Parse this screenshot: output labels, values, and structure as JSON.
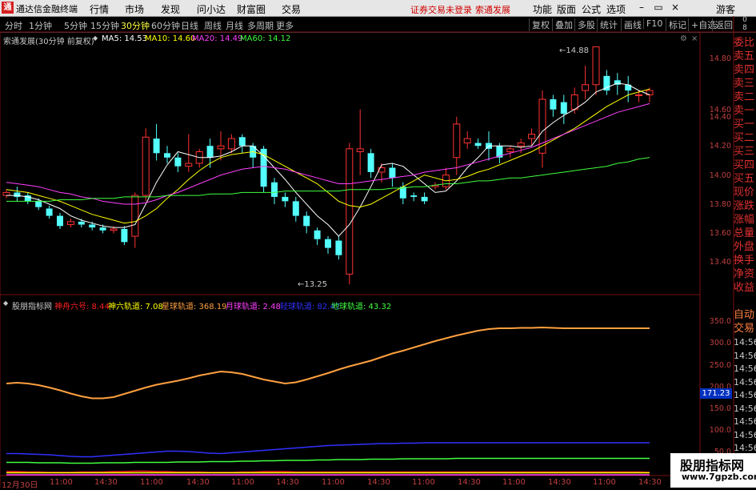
{
  "menubar": {
    "logo": "通",
    "app_title": "通达信金融终端",
    "menus": [
      "行情",
      "市场",
      "发现",
      "问小达",
      "财富圈",
      "交易"
    ],
    "warnings": [
      "证券交易未登录",
      "索通发展"
    ],
    "right_menus": [
      "功能",
      "版面",
      "公式",
      "选项"
    ],
    "user": "游客"
  },
  "toolbar": {
    "periods": [
      "分时",
      "1分钟",
      "5分钟",
      "15分钟",
      "30分钟",
      "60分钟",
      "日线",
      "周线",
      "月线",
      "多周期",
      "更多"
    ],
    "active_period": "30分钟",
    "right_buttons": [
      "复权",
      "叠加",
      "多股",
      "统计",
      "画线",
      "F10",
      "标记",
      "+自选",
      "返回"
    ]
  },
  "main_header": {
    "title": "索通发展(30分钟 前复权)",
    "ma": [
      {
        "label": "MA5: 14.53",
        "color": "#ffffff"
      },
      {
        "label": "MA10: 14.60",
        "color": "#ffff00"
      },
      {
        "label": "MA20: 14.49",
        "color": "#ff40ff"
      },
      {
        "label": "MA60: 14.12",
        "color": "#40ff40"
      }
    ]
  },
  "sub_header": {
    "title": "股朋指标网",
    "items": [
      {
        "label": "神舟六号: 8.44",
        "color": "#ff2020"
      },
      {
        "label": "神六轨道: 7.08",
        "color": "#ffff00"
      },
      {
        "label": "星球轨道: 368.19",
        "color": "#ffa040"
      },
      {
        "label": "月球轨道: 2.48",
        "color": "#ff40ff"
      },
      {
        "label": "轻球轨道: 82.47",
        "color": "#3030ff"
      },
      {
        "label": "地球轨道: 43.32",
        "color": "#40ff40"
      }
    ]
  },
  "price_axis": [
    "14.80",
    "14.60",
    "14.40",
    "14.20",
    "14.00",
    "13.80",
    "13.60",
    "13.40"
  ],
  "indicator_axis": [
    "350.0",
    "300.0",
    "250.0",
    "200.0",
    "150.0",
    "100.0",
    "50.0"
  ],
  "indicator_current": "171.23",
  "annotations": {
    "high": "14.88",
    "low": "13.25"
  },
  "right_panel": {
    "top": [
      "委比",
      "卖五",
      "卖四",
      "卖三",
      "卖二",
      "卖一",
      "买一",
      "买二",
      "买三",
      "买四",
      "买五",
      "现价",
      "涨跌",
      "涨幅",
      "总量",
      "外盘",
      "换手",
      "净资",
      "收益"
    ],
    "bottom_tabs": [
      "自动",
      "交易"
    ],
    "times": [
      "14:56",
      "14:56",
      "14:56",
      "14:56",
      "14:56",
      "14:56",
      "14:56",
      "14:56",
      "14:56",
      "14:56",
      "14:56"
    ]
  },
  "x_axis": [
    "12月30日",
    "11:00",
    "14:30",
    "11:00",
    "14:30",
    "11:00",
    "14:30",
    "11:00",
    "14:30",
    "11:00",
    "14:30",
    "11:00",
    "14:30",
    "11:00",
    "14:30"
  ],
  "badges": [
    "0",
    "8"
  ],
  "colors": {
    "up": "#ff3232",
    "down": "#54ffff",
    "axis": "#c04040"
  },
  "chart_data": {
    "type": "candlestick",
    "ylim": [
      13.2,
      14.95
    ],
    "candles": [
      [
        13.86,
        13.88,
        13.84,
        13.9
      ],
      [
        13.88,
        13.85,
        13.82,
        13.92
      ],
      [
        13.86,
        13.82,
        13.8,
        13.88
      ],
      [
        13.82,
        13.78,
        13.76,
        13.84
      ],
      [
        13.77,
        13.72,
        13.7,
        13.79
      ],
      [
        13.72,
        13.65,
        13.63,
        13.74
      ],
      [
        13.66,
        13.68,
        13.64,
        13.7
      ],
      [
        13.68,
        13.66,
        13.64,
        13.7
      ],
      [
        13.66,
        13.64,
        13.62,
        13.68
      ],
      [
        13.64,
        13.62,
        13.6,
        13.66
      ],
      [
        13.62,
        13.63,
        13.6,
        13.65
      ],
      [
        13.63,
        13.54,
        13.52,
        13.65
      ],
      [
        13.58,
        13.86,
        13.5,
        13.88
      ],
      [
        13.86,
        14.26,
        13.82,
        14.32
      ],
      [
        14.25,
        14.15,
        14.1,
        14.35
      ],
      [
        14.15,
        14.12,
        14.08,
        14.2
      ],
      [
        14.12,
        14.06,
        14.02,
        14.15
      ],
      [
        14.06,
        14.08,
        14.02,
        14.28
      ],
      [
        14.08,
        14.16,
        14.05,
        14.18
      ],
      [
        14.2,
        14.12,
        14.05,
        14.25
      ],
      [
        14.18,
        14.2,
        14.1,
        14.3
      ],
      [
        14.18,
        14.25,
        14.15,
        14.28
      ],
      [
        14.26,
        14.2,
        14.15,
        14.28
      ],
      [
        14.2,
        14.12,
        14.05,
        14.22
      ],
      [
        14.18,
        13.92,
        13.88,
        14.2
      ],
      [
        13.95,
        13.85,
        13.8,
        13.98
      ],
      [
        13.85,
        13.82,
        13.78,
        13.88
      ],
      [
        13.82,
        13.72,
        13.68,
        13.85
      ],
      [
        13.72,
        13.65,
        13.6,
        13.75
      ],
      [
        13.62,
        13.56,
        13.52,
        13.64
      ],
      [
        13.56,
        13.5,
        13.46,
        13.58
      ],
      [
        13.55,
        13.45,
        13.42,
        13.58
      ],
      [
        13.32,
        14.18,
        13.25,
        14.22
      ],
      [
        14.16,
        14.18,
        14.0,
        14.45
      ],
      [
        14.15,
        14.02,
        13.98,
        14.18
      ],
      [
        14.02,
        14.05,
        13.95,
        14.08
      ],
      [
        14.05,
        13.98,
        13.92,
        14.08
      ],
      [
        13.92,
        13.84,
        13.8,
        13.95
      ],
      [
        13.86,
        13.85,
        13.82,
        13.88
      ],
      [
        13.85,
        13.82,
        13.8,
        13.88
      ],
      [
        13.92,
        13.93,
        13.9,
        13.95
      ],
      [
        13.92,
        14.0,
        13.9,
        14.05
      ],
      [
        14.12,
        14.35,
        14.0,
        14.4
      ],
      [
        14.22,
        14.25,
        14.18,
        14.3
      ],
      [
        14.22,
        14.2,
        14.18,
        14.25
      ],
      [
        14.22,
        14.18,
        14.1,
        14.3
      ],
      [
        14.2,
        14.12,
        14.08,
        14.22
      ],
      [
        14.16,
        14.18,
        14.12,
        14.2
      ],
      [
        14.2,
        14.22,
        14.15,
        14.25
      ],
      [
        14.25,
        14.28,
        14.2,
        14.32
      ],
      [
        14.15,
        14.52,
        14.05,
        14.58
      ],
      [
        14.52,
        14.45,
        14.4,
        14.55
      ],
      [
        14.5,
        14.42,
        14.35,
        14.55
      ],
      [
        14.45,
        14.55,
        14.42,
        14.6
      ],
      [
        14.58,
        14.62,
        14.52,
        14.75
      ],
      [
        14.62,
        14.88,
        14.55,
        14.88
      ],
      [
        14.68,
        14.58,
        14.55,
        14.72
      ],
      [
        14.65,
        14.62,
        14.55,
        14.7
      ],
      [
        14.62,
        14.58,
        14.5,
        14.68
      ],
      [
        14.55,
        14.55,
        14.5,
        14.58
      ],
      [
        14.55,
        14.58,
        14.5,
        14.6
      ]
    ],
    "ma_series": [
      {
        "name": "MA5",
        "color": "#ffffff",
        "values": [
          13.86,
          13.86,
          13.85,
          13.83,
          13.8,
          13.77,
          13.72,
          13.69,
          13.67,
          13.65,
          13.64,
          13.64,
          13.66,
          13.8,
          13.95,
          14.07,
          14.16,
          14.14,
          14.12,
          14.12,
          14.13,
          14.16,
          14.2,
          14.2,
          14.13,
          14.05,
          13.97,
          13.88,
          13.8,
          13.72,
          13.66,
          13.58,
          13.66,
          13.78,
          13.92,
          14.07,
          14.08,
          14.06,
          14.0,
          13.94,
          13.88,
          13.89,
          13.96,
          14.05,
          14.12,
          14.2,
          14.2,
          14.2,
          14.19,
          14.2,
          14.3,
          14.36,
          14.41,
          14.45,
          14.5,
          14.57,
          14.6,
          14.63,
          14.62,
          14.58,
          14.55
        ]
      },
      {
        "name": "MA10",
        "color": "#ffff00",
        "values": [
          13.9,
          13.89,
          13.88,
          13.86,
          13.84,
          13.82,
          13.79,
          13.76,
          13.73,
          13.71,
          13.69,
          13.67,
          13.68,
          13.72,
          13.77,
          13.84,
          13.9,
          13.97,
          14.03,
          14.08,
          14.12,
          14.14,
          14.15,
          14.16,
          14.14,
          14.1,
          14.06,
          14.02,
          13.98,
          13.94,
          13.88,
          13.82,
          13.79,
          13.78,
          13.8,
          13.84,
          13.88,
          13.92,
          13.96,
          14.0,
          13.98,
          13.96,
          13.97,
          13.99,
          14.02,
          14.04,
          14.07,
          14.1,
          14.13,
          14.16,
          14.2,
          14.24,
          14.28,
          14.32,
          14.37,
          14.42,
          14.47,
          14.51,
          14.55,
          14.57,
          14.59
        ]
      },
      {
        "name": "MA20",
        "color": "#ff40ff",
        "values": [
          13.95,
          13.94,
          13.93,
          13.92,
          13.9,
          13.88,
          13.87,
          13.85,
          13.84,
          13.82,
          13.81,
          13.8,
          13.8,
          13.81,
          13.83,
          13.86,
          13.88,
          13.91,
          13.94,
          13.97,
          14.0,
          14.02,
          14.04,
          14.05,
          14.06,
          14.05,
          14.04,
          14.02,
          14.0,
          13.98,
          13.96,
          13.94,
          13.94,
          13.95,
          13.96,
          13.97,
          13.98,
          13.99,
          14.0,
          14.02,
          14.03,
          14.04,
          14.05,
          14.07,
          14.09,
          14.11,
          14.13,
          14.15,
          14.17,
          14.19,
          14.22,
          14.25,
          14.28,
          14.31,
          14.34,
          14.37,
          14.4,
          14.43,
          14.45,
          14.47,
          14.49
        ]
      },
      {
        "name": "MA60",
        "color": "#40ff40",
        "values": [
          13.82,
          13.82,
          13.82,
          13.82,
          13.82,
          13.83,
          13.83,
          13.83,
          13.84,
          13.84,
          13.84,
          13.85,
          13.85,
          13.85,
          13.85,
          13.86,
          13.86,
          13.86,
          13.86,
          13.87,
          13.87,
          13.87,
          13.88,
          13.88,
          13.88,
          13.88,
          13.89,
          13.89,
          13.89,
          13.89,
          13.89,
          13.89,
          13.9,
          13.9,
          13.9,
          13.9,
          13.91,
          13.91,
          13.92,
          13.92,
          13.93,
          13.94,
          13.94,
          13.95,
          13.96,
          13.96,
          13.97,
          13.98,
          13.98,
          13.99,
          14.0,
          14.01,
          14.02,
          14.03,
          14.04,
          14.05,
          14.06,
          14.08,
          14.09,
          14.11,
          14.12
        ]
      }
    ],
    "indicator_ylim": [
      0,
      400
    ],
    "indicator_series": [
      {
        "name": "星球轨道",
        "color": "#ffa040",
        "values": [
          230,
          232,
          230,
          226,
          220,
          213,
          205,
          198,
          193,
          193,
          196,
          204,
          212,
          220,
          227,
          232,
          237,
          243,
          250,
          255,
          260,
          258,
          254,
          247,
          240,
          235,
          230,
          233,
          240,
          248,
          256,
          265,
          273,
          280,
          287,
          296,
          305,
          312,
          320,
          328,
          336,
          343,
          350,
          356,
          362,
          366,
          368,
          368,
          369,
          369,
          370,
          369,
          368,
          368,
          368,
          368,
          368,
          368,
          368,
          368,
          368
        ]
      },
      {
        "name": "轻球轨道",
        "color": "#3030ff",
        "values": [
          55,
          55,
          54,
          53,
          52,
          50,
          48,
          47,
          47,
          49,
          51,
          53,
          55,
          57,
          59,
          61,
          61,
          60,
          58,
          56,
          55,
          57,
          59,
          61,
          63,
          65,
          67,
          69,
          71,
          73,
          75,
          76,
          77,
          78,
          79,
          80,
          80,
          81,
          81,
          82,
          82,
          82,
          82,
          82,
          82,
          82,
          82,
          82,
          82,
          82,
          82,
          82,
          82,
          82,
          82,
          82,
          82,
          82,
          82,
          82,
          82
        ]
      },
      {
        "name": "地球轨道",
        "color": "#40ff40",
        "values": [
          33,
          33,
          33,
          32,
          32,
          32,
          31,
          31,
          31,
          32,
          32,
          32,
          33,
          33,
          33,
          33,
          34,
          34,
          34,
          35,
          35,
          35,
          36,
          36,
          37,
          37,
          38,
          38,
          38,
          39,
          39,
          40,
          40,
          40,
          41,
          41,
          41,
          42,
          42,
          42,
          42,
          42,
          43,
          43,
          43,
          43,
          43,
          43,
          43,
          43,
          43,
          43,
          43,
          43,
          43,
          43,
          43,
          43,
          43,
          43,
          43
        ]
      },
      {
        "name": "神舟六号",
        "color": "#ff2020",
        "values": [
          10,
          10,
          9,
          9,
          8,
          8,
          8,
          9,
          9,
          9,
          10,
          10,
          11,
          11,
          10,
          10,
          9,
          9,
          9,
          8,
          8,
          8,
          9,
          9,
          10,
          10,
          10,
          9,
          9,
          9,
          9,
          9,
          9,
          9,
          9,
          9,
          9,
          9,
          9,
          9,
          9,
          9,
          9,
          9,
          9,
          9,
          9,
          9,
          9,
          9,
          9,
          9,
          9,
          9,
          9,
          9,
          9,
          9,
          9,
          9,
          8
        ]
      },
      {
        "name": "神六轨道",
        "color": "#ffff00",
        "values": [
          7,
          7,
          7,
          7,
          7,
          7,
          7,
          7,
          7,
          7,
          7,
          7,
          7,
          7,
          7,
          7,
          7,
          7,
          7,
          7,
          7,
          7,
          7,
          7,
          7,
          7,
          7,
          7,
          7,
          7,
          7,
          7,
          7,
          7,
          7,
          7,
          7,
          7,
          7,
          7,
          7,
          7,
          7,
          7,
          7,
          7,
          7,
          7,
          7,
          7,
          7,
          7,
          7,
          7,
          7,
          7,
          7,
          7,
          7,
          7,
          7
        ]
      },
      {
        "name": "月球轨道",
        "color": "#ff40ff",
        "values": [
          2,
          2,
          2,
          2,
          2,
          2,
          2,
          2,
          2,
          2,
          2,
          2,
          2,
          2,
          2,
          2,
          2,
          2,
          2,
          2,
          2,
          2,
          2,
          2,
          2,
          2,
          2,
          2,
          2,
          2,
          2,
          2,
          2,
          2,
          2,
          2,
          2,
          2,
          2,
          2,
          2,
          2,
          2,
          2,
          2,
          2,
          2,
          2,
          2,
          2,
          2,
          2,
          2,
          2,
          2,
          2,
          2,
          2,
          2,
          2,
          2
        ]
      }
    ]
  },
  "watermark": {
    "line1": "股朋指标网",
    "line2": "www.7gpzb.com"
  }
}
